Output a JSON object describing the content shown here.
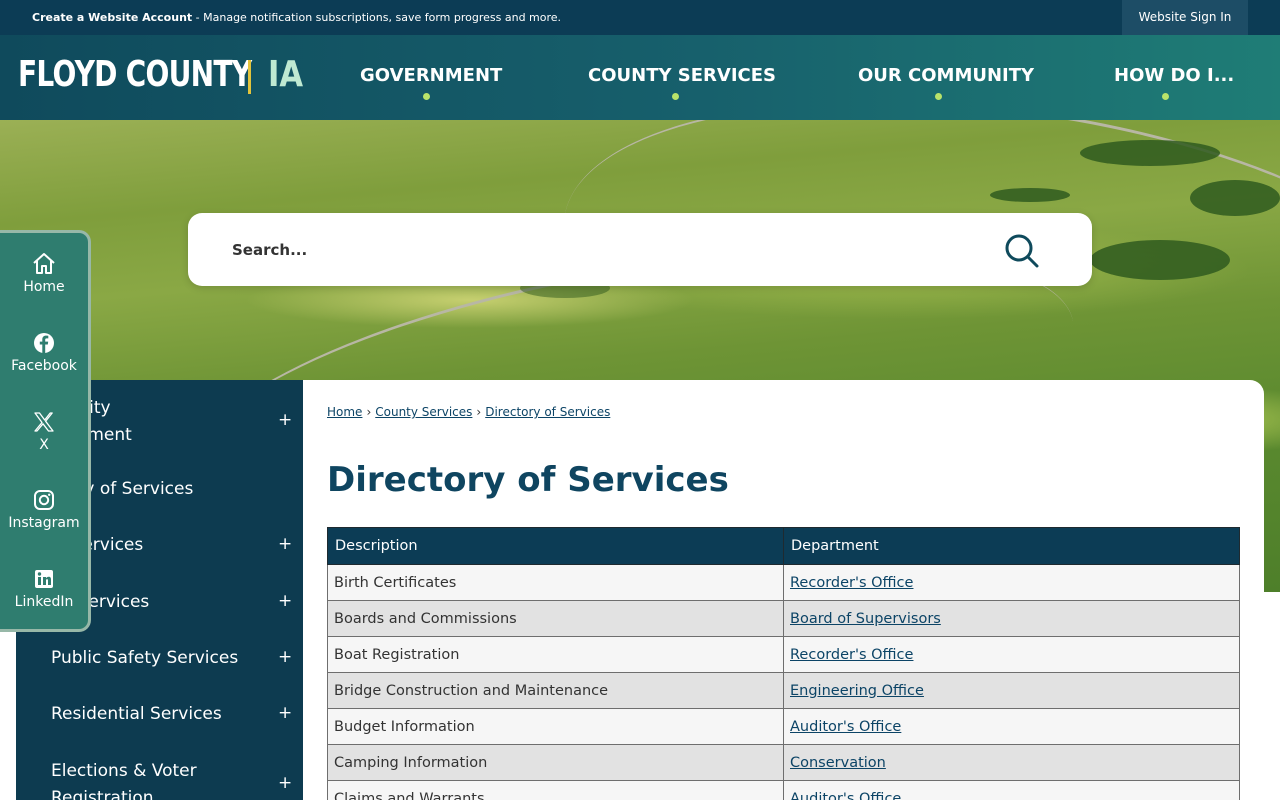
{
  "topbar": {
    "create_account": "Create a Website Account",
    "message": " - Manage notification subscriptions, save form progress and more.",
    "sign_in": "Website Sign In"
  },
  "header": {
    "logo_county": "FLOYD COUNTY",
    "logo_state": "IA",
    "nav": [
      "GOVERNMENT",
      "COUNTY SERVICES",
      "OUR COMMUNITY",
      "HOW DO I..."
    ]
  },
  "search": {
    "placeholder": "Search..."
  },
  "social": {
    "items": [
      "Home",
      "Facebook",
      "X",
      "Instagram",
      "LinkedIn"
    ]
  },
  "sidenav": {
    "items": [
      "Community Development",
      "Directory of Services",
      "Legal Services",
      "Human Services",
      "Public Safety Services",
      "Residential Services",
      "Elections & Voter Registration"
    ],
    "visible": [
      [
        "munity",
        "elopment"
      ],
      "ctory of Services",
      "al Services",
      "an Services",
      "Public Safety Services",
      "Residential Services",
      [
        "Elections & Voter",
        "Registration"
      ]
    ],
    "plus": "+"
  },
  "breadcrumb": {
    "home": "Home",
    "county_services": "County Services",
    "current": "Directory of Services",
    "separator": "›"
  },
  "page_title": "Directory of Services",
  "table": {
    "headers": [
      "Description",
      "Department"
    ],
    "rows": [
      [
        "Birth Certificates",
        "Recorder's Office"
      ],
      [
        "Boards and Commissions",
        "Board of Supervisors"
      ],
      [
        "Boat Registration",
        "Recorder's Office"
      ],
      [
        "Bridge Construction and Maintenance",
        "Engineering Office"
      ],
      [
        "Budget Information",
        "Auditor's Office"
      ],
      [
        "Camping Information",
        "Conservation"
      ],
      [
        "Claims and Warrants",
        "Auditor's Office"
      ]
    ]
  },
  "colors": {
    "topbar": "#0c3c55",
    "header_start": "#0f4a5c",
    "header_end": "#1f7d76",
    "accent_dot": "#b9e36a",
    "logo_bar": "#e3c43c",
    "sidenav": "#0d3b50",
    "social": "#2f7d6f",
    "title": "#0f4560"
  },
  "icons": {
    "search": "search-icon",
    "home": "home-icon",
    "facebook": "facebook-icon",
    "x": "x-icon",
    "instagram": "instagram-icon",
    "linkedin": "linkedin-icon"
  }
}
